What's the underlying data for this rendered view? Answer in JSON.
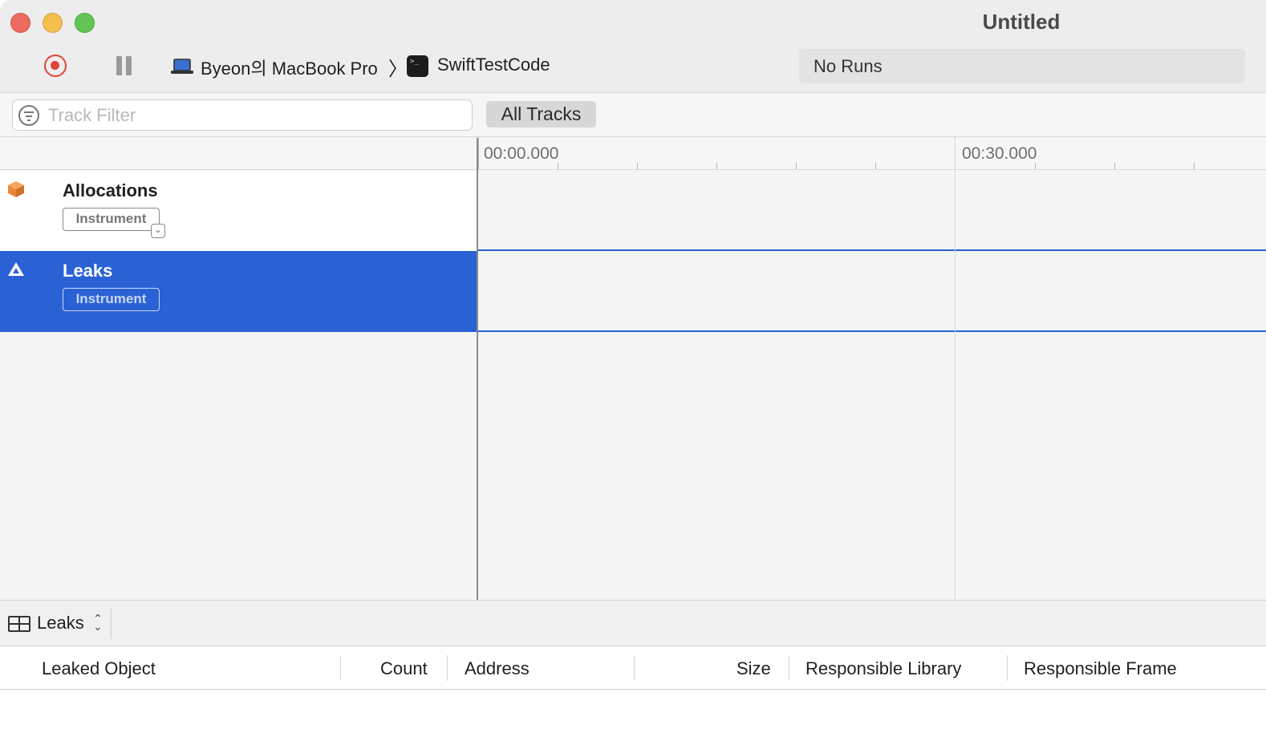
{
  "window": {
    "title": "Untitled"
  },
  "toolbar": {
    "record_button_icon": "record-icon",
    "pause_button_icon": "pause-icon",
    "device_name": "Byeon의 MacBook Pro",
    "breadcrumb_separator": "〉",
    "target_name": "SwiftTestCode",
    "runs_label": "No Runs"
  },
  "filter_bar": {
    "track_filter_placeholder": "Track Filter",
    "track_filter_value": "",
    "all_tracks_label": "All Tracks"
  },
  "timeline": {
    "ruler_labels": [
      "00:00.000",
      "00:30.000"
    ]
  },
  "tracks": [
    {
      "name": "Allocations",
      "badge": "Instrument",
      "icon": "allocations-cube-icon",
      "icon_color": "#e8873a",
      "selected": false
    },
    {
      "name": "Leaks",
      "badge": "Instrument",
      "icon": "leaks-warning-icon",
      "icon_color": "#ffffff",
      "selected": true
    }
  ],
  "detail": {
    "view_icon": "table-grid-icon",
    "selected_view": "Leaks",
    "columns": [
      "Leaked Object",
      "Count",
      "Address",
      "Size",
      "Responsible Library",
      "Responsible Frame"
    ],
    "rows": []
  },
  "colors": {
    "selection_blue": "#2a62d6",
    "record_red": "#e0443a",
    "close": "#ed6a5e",
    "minimize": "#f5bf4f",
    "zoom": "#62c554"
  }
}
